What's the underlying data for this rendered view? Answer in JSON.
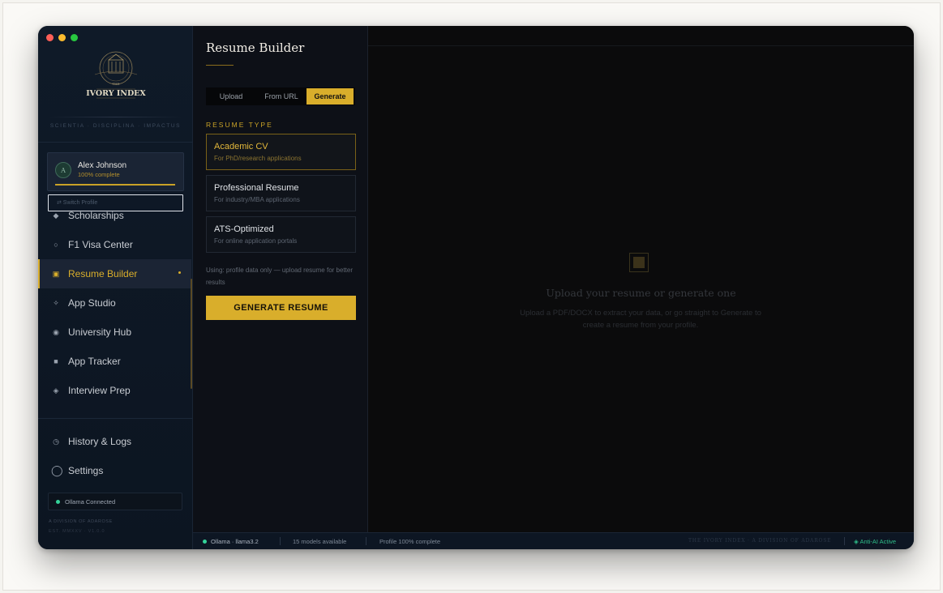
{
  "window": {
    "traffic_lights": [
      "#ff5f57",
      "#febc2e",
      "#28c840"
    ]
  },
  "sidebar": {
    "logo_text": "IVORY INDEX",
    "logo_small": "THE",
    "motto": "SCIENTIA · DISCIPLINA · IMPACTUS",
    "profile": {
      "initial": "A",
      "name": "Alex Johnson",
      "status": "100% complete",
      "progress": 1.0
    },
    "switch_profile": "⇄ Switch Profile",
    "nav": [
      {
        "label": "Scholarships",
        "icon": "◆",
        "icon_name": "diamond-icon"
      },
      {
        "label": "F1 Visa Center",
        "icon": "○",
        "icon_name": "circle-icon"
      },
      {
        "label": "Resume Builder",
        "icon": "▣",
        "icon_name": "document-icon",
        "active": true
      },
      {
        "label": "App Studio",
        "icon": "✧",
        "icon_name": "sparkle-icon"
      },
      {
        "label": "University Hub",
        "icon": "◉",
        "icon_name": "university-icon"
      },
      {
        "label": "App Tracker",
        "icon": "■",
        "icon_name": "tracker-icon"
      },
      {
        "label": "Interview Prep",
        "icon": "◈",
        "icon_name": "interview-icon"
      }
    ],
    "bottom_nav": [
      {
        "label": "History & Logs",
        "icon": "◷",
        "icon_name": "clock-icon"
      },
      {
        "label": "Settings",
        "icon": "◯",
        "icon_name": "settings-icon"
      }
    ],
    "ollama_status": "Ollama Connected",
    "division": "A DIVISION OF ADAROSE",
    "est": "EST. MMXXV · V1.0.0"
  },
  "panel": {
    "title": "Resume Builder",
    "tabs": [
      "Upload",
      "From URL",
      "Generate"
    ],
    "active_tab": "Generate",
    "section_label": "RESUME TYPE",
    "resume_types": [
      {
        "title": "Academic CV",
        "subtitle": "For PhD/research applications",
        "selected": true
      },
      {
        "title": "Professional Resume",
        "subtitle": "For industry/MBA applications"
      },
      {
        "title": "ATS-Optimized",
        "subtitle": "For online application portals"
      }
    ],
    "using_note": "Using: profile data only — upload resume for better results",
    "generate_button": "GENERATE RESUME"
  },
  "main": {
    "empty_title": "Upload your resume or generate one",
    "empty_subtitle": "Upload a PDF/DOCX to extract your data, or go straight to Generate to create a resume from your profile."
  },
  "statusbar": {
    "model": "Ollama · llama3.2",
    "models_available": "15 models available",
    "profile": "Profile 100% complete",
    "brand": "THE IVORY INDEX · A DIVISION OF ADAROSE",
    "anti_ai": "◈ Anti-AI Active"
  },
  "colors": {
    "accent": "#d9ae2b",
    "status_green": "#34d399"
  }
}
